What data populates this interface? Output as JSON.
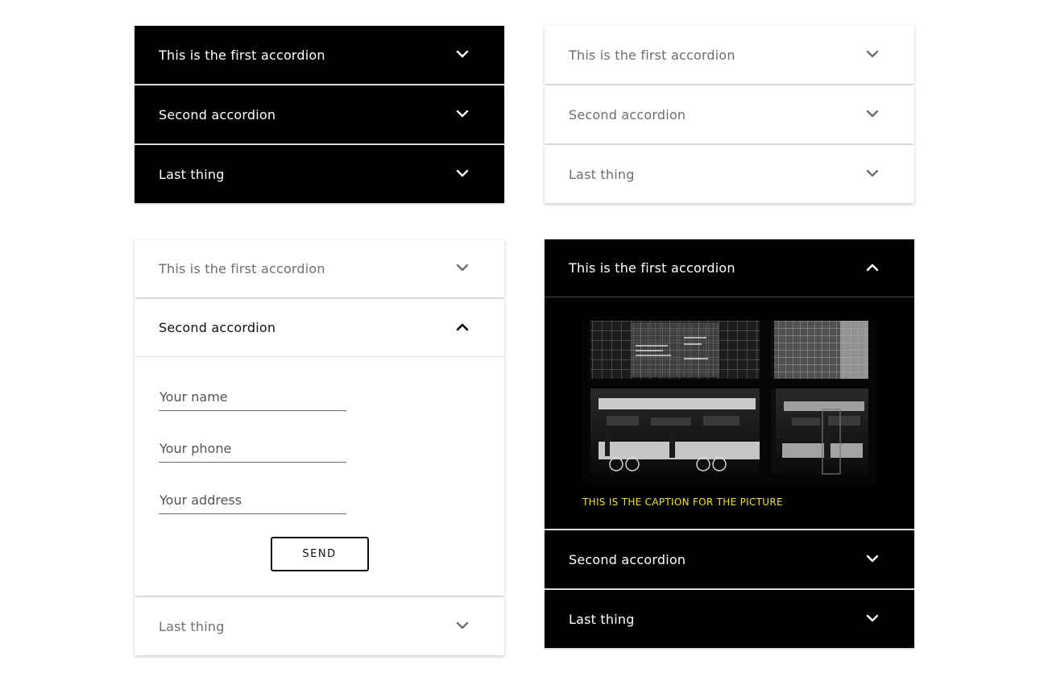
{
  "accordion_a": {
    "items": [
      {
        "label": "This is the first accordion",
        "state": "collapsed"
      },
      {
        "label": "Second accordion",
        "state": "collapsed"
      },
      {
        "label": "Last thing",
        "state": "collapsed"
      }
    ],
    "theme": "dark"
  },
  "accordion_b": {
    "items": [
      {
        "label": "This is the first accordion",
        "state": "collapsed"
      },
      {
        "label": "Second accordion",
        "state": "collapsed"
      },
      {
        "label": "Last thing",
        "state": "collapsed"
      }
    ],
    "theme": "light"
  },
  "accordion_c": {
    "items": [
      {
        "label": "This is the first accordion",
        "state": "collapsed"
      },
      {
        "label": "Second accordion",
        "state": "expanded"
      },
      {
        "label": "Last thing",
        "state": "collapsed"
      }
    ],
    "theme": "light",
    "form": {
      "name_placeholder": "Your name",
      "phone_placeholder": "Your phone",
      "address_placeholder": "Your address",
      "send_label": "SEND"
    }
  },
  "accordion_d": {
    "items": [
      {
        "label": "This is the first accordion",
        "state": "expanded"
      },
      {
        "label": "Second accordion",
        "state": "collapsed"
      },
      {
        "label": "Last thing",
        "state": "collapsed"
      }
    ],
    "theme": "dark",
    "picture": {
      "image": "black-and-white-office-window-photo",
      "caption": "THIS IS THE CAPTION FOR THE PICTURE"
    }
  },
  "icons": {
    "collapsed": "chevron-down-icon",
    "expanded": "chevron-up-icon"
  },
  "colors": {
    "dark_panel": "#000000",
    "light_panel": "#ffffff",
    "caption": "#f5e21f"
  }
}
